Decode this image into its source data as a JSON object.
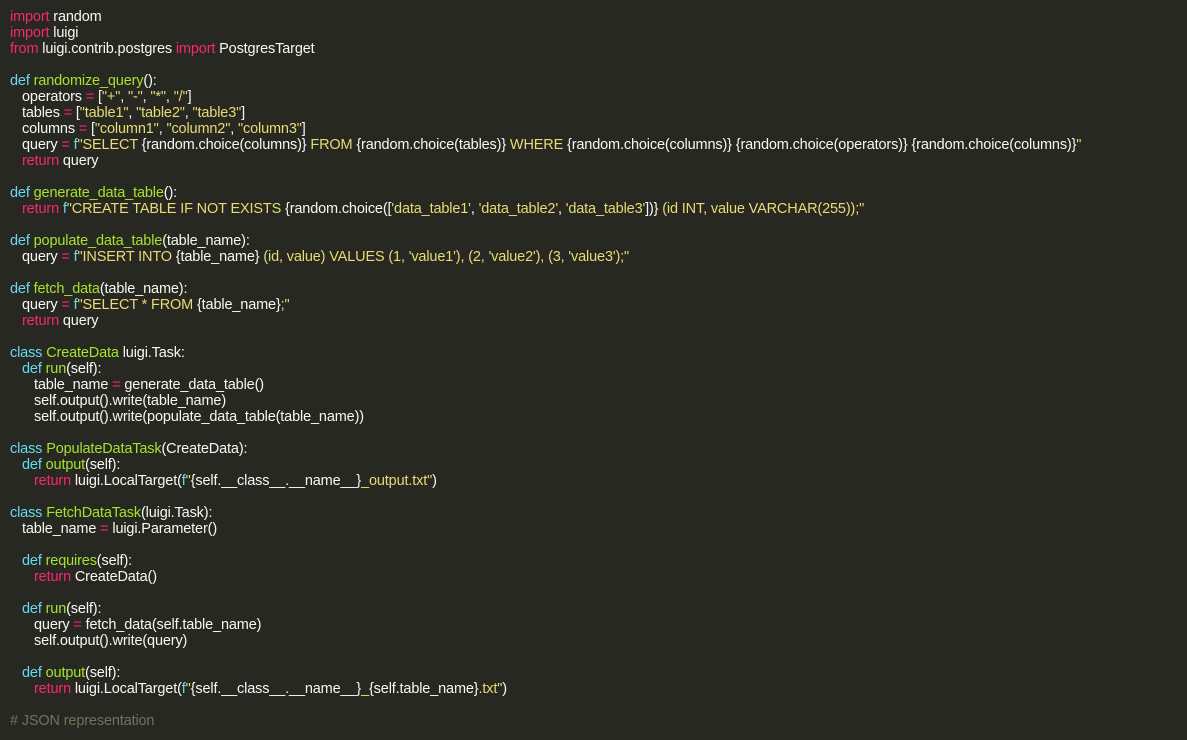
{
  "editor": {
    "theme_colors": {
      "background": "#272822",
      "text": "#f8f8f2",
      "keyword": "#f92672",
      "def_keyword": "#66d9ef",
      "function_name": "#a6e22e",
      "string": "#e6db74",
      "comment": "#75715e"
    },
    "lines": [
      {
        "indent": 0,
        "tokens": [
          {
            "t": "kw",
            "v": "import"
          },
          {
            "t": "pl",
            "v": " random"
          }
        ]
      },
      {
        "indent": 0,
        "tokens": [
          {
            "t": "kw",
            "v": "import"
          },
          {
            "t": "pl",
            "v": " luigi"
          }
        ]
      },
      {
        "indent": 0,
        "tokens": [
          {
            "t": "kw",
            "v": "from"
          },
          {
            "t": "pl",
            "v": " luigi.contrib.postgres "
          },
          {
            "t": "kw",
            "v": "import"
          },
          {
            "t": "pl",
            "v": " PostgresTarget"
          }
        ]
      },
      {
        "indent": 0,
        "tokens": []
      },
      {
        "indent": 0,
        "tokens": [
          {
            "t": "dk",
            "v": "def"
          },
          {
            "t": "pl",
            "v": " "
          },
          {
            "t": "fn",
            "v": "randomize_query"
          },
          {
            "t": "pl",
            "v": "():"
          }
        ]
      },
      {
        "indent": 1,
        "tokens": [
          {
            "t": "pl",
            "v": "operators "
          },
          {
            "t": "kw",
            "v": "="
          },
          {
            "t": "pl",
            "v": " ["
          },
          {
            "t": "st",
            "v": "\"+\""
          },
          {
            "t": "pl",
            "v": ", "
          },
          {
            "t": "st",
            "v": "\"-\""
          },
          {
            "t": "pl",
            "v": ", "
          },
          {
            "t": "st",
            "v": "\"*\""
          },
          {
            "t": "pl",
            "v": ", "
          },
          {
            "t": "st",
            "v": "\"/\""
          },
          {
            "t": "pl",
            "v": "]"
          }
        ]
      },
      {
        "indent": 1,
        "tokens": [
          {
            "t": "pl",
            "v": "tables "
          },
          {
            "t": "kw",
            "v": "="
          },
          {
            "t": "pl",
            "v": " ["
          },
          {
            "t": "st",
            "v": "\"table1\""
          },
          {
            "t": "pl",
            "v": ", "
          },
          {
            "t": "st",
            "v": "\"table2\""
          },
          {
            "t": "pl",
            "v": ", "
          },
          {
            "t": "st",
            "v": "\"table3\""
          },
          {
            "t": "pl",
            "v": "]"
          }
        ]
      },
      {
        "indent": 1,
        "tokens": [
          {
            "t": "pl",
            "v": "columns "
          },
          {
            "t": "kw",
            "v": "="
          },
          {
            "t": "pl",
            "v": " ["
          },
          {
            "t": "st",
            "v": "\"column1\""
          },
          {
            "t": "pl",
            "v": ", "
          },
          {
            "t": "st",
            "v": "\"column2\""
          },
          {
            "t": "pl",
            "v": ", "
          },
          {
            "t": "st",
            "v": "\"column3\""
          },
          {
            "t": "pl",
            "v": "]"
          }
        ]
      },
      {
        "indent": 1,
        "tokens": [
          {
            "t": "pl",
            "v": "query "
          },
          {
            "t": "kw",
            "v": "="
          },
          {
            "t": "pl",
            "v": " "
          },
          {
            "t": "dk",
            "v": "f"
          },
          {
            "t": "st",
            "v": "\"SELECT "
          },
          {
            "t": "pl",
            "v": "{random.choice(columns)}"
          },
          {
            "t": "st",
            "v": " FROM "
          },
          {
            "t": "pl",
            "v": "{random.choice(tables)}"
          },
          {
            "t": "st",
            "v": " WHERE "
          },
          {
            "t": "pl",
            "v": "{random.choice(columns)}"
          },
          {
            "t": "st",
            "v": " "
          },
          {
            "t": "pl",
            "v": "{random.choice(operators)}"
          },
          {
            "t": "st",
            "v": " "
          },
          {
            "t": "pl",
            "v": "{random.choice(columns)}"
          },
          {
            "t": "st",
            "v": "\""
          }
        ]
      },
      {
        "indent": 1,
        "tokens": [
          {
            "t": "kw",
            "v": "return"
          },
          {
            "t": "pl",
            "v": " query"
          }
        ]
      },
      {
        "indent": 0,
        "tokens": []
      },
      {
        "indent": 0,
        "tokens": [
          {
            "t": "dk",
            "v": "def"
          },
          {
            "t": "pl",
            "v": " "
          },
          {
            "t": "fn",
            "v": "generate_data_table"
          },
          {
            "t": "pl",
            "v": "():"
          }
        ]
      },
      {
        "indent": 1,
        "tokens": [
          {
            "t": "kw",
            "v": "return"
          },
          {
            "t": "pl",
            "v": " "
          },
          {
            "t": "dk",
            "v": "f"
          },
          {
            "t": "st",
            "v": "\"CREATE TABLE IF NOT EXISTS "
          },
          {
            "t": "pl",
            "v": "{random.choice(["
          },
          {
            "t": "st",
            "v": "'data_table1'"
          },
          {
            "t": "pl",
            "v": ", "
          },
          {
            "t": "st",
            "v": "'data_table2'"
          },
          {
            "t": "pl",
            "v": ", "
          },
          {
            "t": "st",
            "v": "'data_table3'"
          },
          {
            "t": "pl",
            "v": "])}"
          },
          {
            "t": "st",
            "v": " (id INT, value VARCHAR(255));\""
          }
        ]
      },
      {
        "indent": 0,
        "tokens": []
      },
      {
        "indent": 0,
        "tokens": [
          {
            "t": "dk",
            "v": "def"
          },
          {
            "t": "pl",
            "v": " "
          },
          {
            "t": "fn",
            "v": "populate_data_table"
          },
          {
            "t": "pl",
            "v": "(table_name):"
          }
        ]
      },
      {
        "indent": 1,
        "tokens": [
          {
            "t": "pl",
            "v": "query "
          },
          {
            "t": "kw",
            "v": "="
          },
          {
            "t": "pl",
            "v": " "
          },
          {
            "t": "dk",
            "v": "f"
          },
          {
            "t": "st",
            "v": "\"INSERT INTO "
          },
          {
            "t": "pl",
            "v": "{table_name}"
          },
          {
            "t": "st",
            "v": " (id, value) VALUES (1, 'value1'), (2, 'value2'), (3, 'value3');\""
          }
        ]
      },
      {
        "indent": 0,
        "tokens": []
      },
      {
        "indent": 0,
        "tokens": [
          {
            "t": "dk",
            "v": "def"
          },
          {
            "t": "pl",
            "v": " "
          },
          {
            "t": "fn",
            "v": "fetch_data"
          },
          {
            "t": "pl",
            "v": "(table_name):"
          }
        ]
      },
      {
        "indent": 1,
        "tokens": [
          {
            "t": "pl",
            "v": "query "
          },
          {
            "t": "kw",
            "v": "="
          },
          {
            "t": "pl",
            "v": " "
          },
          {
            "t": "dk",
            "v": "f"
          },
          {
            "t": "st",
            "v": "\"SELECT * FROM "
          },
          {
            "t": "pl",
            "v": "{table_name}"
          },
          {
            "t": "st",
            "v": ";\""
          }
        ]
      },
      {
        "indent": 1,
        "tokens": [
          {
            "t": "kw",
            "v": "return"
          },
          {
            "t": "pl",
            "v": " query"
          }
        ]
      },
      {
        "indent": 0,
        "tokens": []
      },
      {
        "indent": 0,
        "tokens": [
          {
            "t": "dk",
            "v": "class"
          },
          {
            "t": "pl",
            "v": " "
          },
          {
            "t": "fn",
            "v": "CreateData"
          },
          {
            "t": "pl",
            "v": " luigi.Task:"
          }
        ]
      },
      {
        "indent": 1,
        "tokens": [
          {
            "t": "dk",
            "v": "def"
          },
          {
            "t": "pl",
            "v": " "
          },
          {
            "t": "fn",
            "v": "run"
          },
          {
            "t": "pl",
            "v": "(self):"
          }
        ]
      },
      {
        "indent": 2,
        "tokens": [
          {
            "t": "pl",
            "v": "table_name "
          },
          {
            "t": "kw",
            "v": "="
          },
          {
            "t": "pl",
            "v": " generate_data_table()"
          }
        ]
      },
      {
        "indent": 2,
        "tokens": [
          {
            "t": "pl",
            "v": "self.output().write(table_name)"
          }
        ]
      },
      {
        "indent": 2,
        "tokens": [
          {
            "t": "pl",
            "v": "self.output().write(populate_data_table(table_name))"
          }
        ]
      },
      {
        "indent": 0,
        "tokens": []
      },
      {
        "indent": 0,
        "tokens": [
          {
            "t": "dk",
            "v": "class"
          },
          {
            "t": "pl",
            "v": " "
          },
          {
            "t": "fn",
            "v": "PopulateDataTask"
          },
          {
            "t": "pl",
            "v": "(CreateData):"
          }
        ]
      },
      {
        "indent": 1,
        "tokens": [
          {
            "t": "dk",
            "v": "def"
          },
          {
            "t": "pl",
            "v": " "
          },
          {
            "t": "fn",
            "v": "output"
          },
          {
            "t": "pl",
            "v": "(self):"
          }
        ]
      },
      {
        "indent": 2,
        "tokens": [
          {
            "t": "kw",
            "v": "return"
          },
          {
            "t": "pl",
            "v": " luigi.LocalTarget("
          },
          {
            "t": "dk",
            "v": "f"
          },
          {
            "t": "st",
            "v": "\""
          },
          {
            "t": "pl",
            "v": "{self.__class__.__name__}"
          },
          {
            "t": "st",
            "v": "_output.txt\""
          },
          {
            "t": "pl",
            "v": ")"
          }
        ]
      },
      {
        "indent": 0,
        "tokens": []
      },
      {
        "indent": 0,
        "tokens": [
          {
            "t": "dk",
            "v": "class"
          },
          {
            "t": "pl",
            "v": " "
          },
          {
            "t": "fn",
            "v": "FetchDataTask"
          },
          {
            "t": "pl",
            "v": "(luigi.Task):"
          }
        ]
      },
      {
        "indent": 1,
        "tokens": [
          {
            "t": "pl",
            "v": "table_name "
          },
          {
            "t": "kw",
            "v": "="
          },
          {
            "t": "pl",
            "v": " luigi.Parameter()"
          }
        ]
      },
      {
        "indent": 0,
        "tokens": []
      },
      {
        "indent": 1,
        "tokens": [
          {
            "t": "dk",
            "v": "def"
          },
          {
            "t": "pl",
            "v": " "
          },
          {
            "t": "fn",
            "v": "requires"
          },
          {
            "t": "pl",
            "v": "(self):"
          }
        ]
      },
      {
        "indent": 2,
        "tokens": [
          {
            "t": "kw",
            "v": "return"
          },
          {
            "t": "pl",
            "v": " CreateData()"
          }
        ]
      },
      {
        "indent": 0,
        "tokens": []
      },
      {
        "indent": 1,
        "tokens": [
          {
            "t": "dk",
            "v": "def"
          },
          {
            "t": "pl",
            "v": " "
          },
          {
            "t": "fn",
            "v": "run"
          },
          {
            "t": "pl",
            "v": "(self):"
          }
        ]
      },
      {
        "indent": 2,
        "tokens": [
          {
            "t": "pl",
            "v": "query "
          },
          {
            "t": "kw",
            "v": "="
          },
          {
            "t": "pl",
            "v": " fetch_data(self.table_name)"
          }
        ]
      },
      {
        "indent": 2,
        "tokens": [
          {
            "t": "pl",
            "v": "self.output().write(query)"
          }
        ]
      },
      {
        "indent": 0,
        "tokens": []
      },
      {
        "indent": 1,
        "tokens": [
          {
            "t": "dk",
            "v": "def"
          },
          {
            "t": "pl",
            "v": " "
          },
          {
            "t": "fn",
            "v": "output"
          },
          {
            "t": "pl",
            "v": "(self):"
          }
        ]
      },
      {
        "indent": 2,
        "tokens": [
          {
            "t": "kw",
            "v": "return"
          },
          {
            "t": "pl",
            "v": " luigi.LocalTarget("
          },
          {
            "t": "dk",
            "v": "f"
          },
          {
            "t": "st",
            "v": "\""
          },
          {
            "t": "pl",
            "v": "{self.__class__.__name__}"
          },
          {
            "t": "st",
            "v": "_"
          },
          {
            "t": "pl",
            "v": "{self.table_name}"
          },
          {
            "t": "st",
            "v": ".txt\""
          },
          {
            "t": "pl",
            "v": ")"
          }
        ]
      },
      {
        "indent": 0,
        "tokens": []
      },
      {
        "indent": 0,
        "tokens": [
          {
            "t": "cm",
            "v": "# JSON representation"
          }
        ]
      }
    ]
  }
}
